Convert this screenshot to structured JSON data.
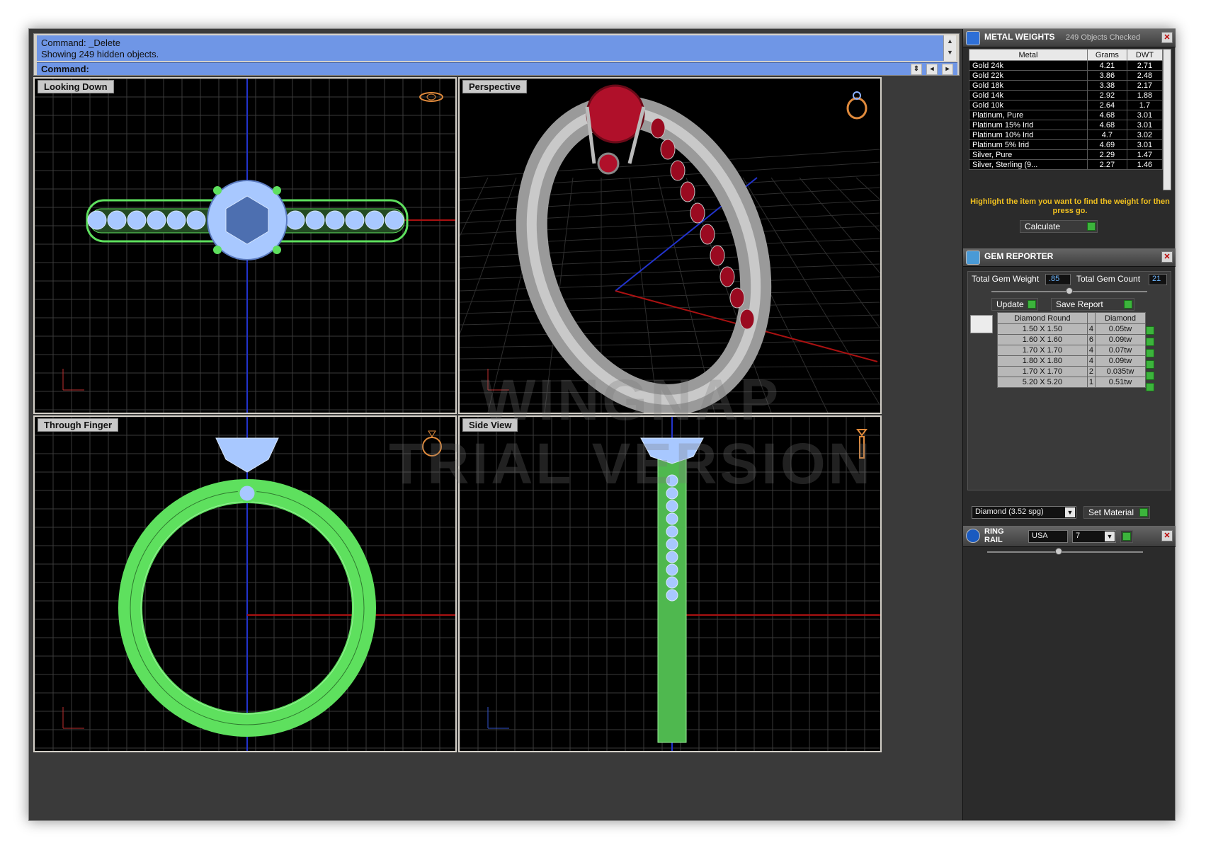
{
  "command": {
    "history": [
      "Command: _Delete",
      "Showing 249 hidden objects."
    ],
    "prompt": "Command:",
    "input_value": ""
  },
  "viewports": [
    {
      "label": "Looking Down"
    },
    {
      "label": "Perspective"
    },
    {
      "label": "Through Finger"
    },
    {
      "label": "Side View"
    }
  ],
  "watermark": {
    "line1": "WINGNAP",
    "line2": "TRIAL VERSION"
  },
  "metal_weights": {
    "title": "METAL WEIGHTS",
    "subtitle": "249 Objects Checked",
    "columns": [
      "Metal",
      "Grams",
      "DWT"
    ],
    "rows": [
      [
        "Gold 24k",
        "4.21",
        "2.71"
      ],
      [
        "Gold 22k",
        "3.86",
        "2.48"
      ],
      [
        "Gold 18k",
        "3.38",
        "2.17"
      ],
      [
        "Gold 14k",
        "2.92",
        "1.88"
      ],
      [
        "Gold 10k",
        "2.64",
        "1.7"
      ],
      [
        "Platinum, Pure",
        "4.68",
        "3.01"
      ],
      [
        "Platinum 15% Irid",
        "4.68",
        "3.01"
      ],
      [
        "Platinum 10% Irid",
        "4.7",
        "3.02"
      ],
      [
        "Platinum 5% Irid",
        "4.69",
        "3.01"
      ],
      [
        "Silver, Pure",
        "2.29",
        "1.47"
      ],
      [
        "Silver, Sterling (9...",
        "2.27",
        "1.46"
      ]
    ],
    "hint": "Highlight the item you want to find the weight for then press go.",
    "calculate_label": "Calculate"
  },
  "gem_reporter": {
    "title": "GEM REPORTER",
    "total_weight_label": "Total Gem Weight",
    "total_weight_value": ".85",
    "total_count_label": "Total Gem Count",
    "total_count_value": "21",
    "update_label": "Update",
    "save_report_label": "Save Report",
    "columns": [
      "Diamond Round",
      "",
      "Diamond"
    ],
    "rows": [
      [
        "1.50 X 1.50",
        "4",
        "0.05tw"
      ],
      [
        "1.60 X 1.60",
        "6",
        "0.09tw"
      ],
      [
        "1.70 X 1.70",
        "4",
        "0.07tw"
      ],
      [
        "1.80 X 1.80",
        "4",
        "0.09tw"
      ],
      [
        "1.70 X 1.70",
        "2",
        "0.035tw"
      ],
      [
        "5.20 X 5.20",
        "1",
        "0.51tw"
      ]
    ],
    "material_select": "Diamond    (3.52 spg)",
    "set_material_label": "Set Material"
  },
  "ring_rail": {
    "title_line1": "RING",
    "title_line2": "RAIL",
    "standard": "USA",
    "size": "7"
  },
  "colors": {
    "command_bg": "#6f96e6",
    "wireframe_green": "#5ee05e",
    "gem_blue": "#a8c8ff",
    "ruby": "#b0102a",
    "go_button": "#3cb43c",
    "hint_text": "#f0c020"
  }
}
